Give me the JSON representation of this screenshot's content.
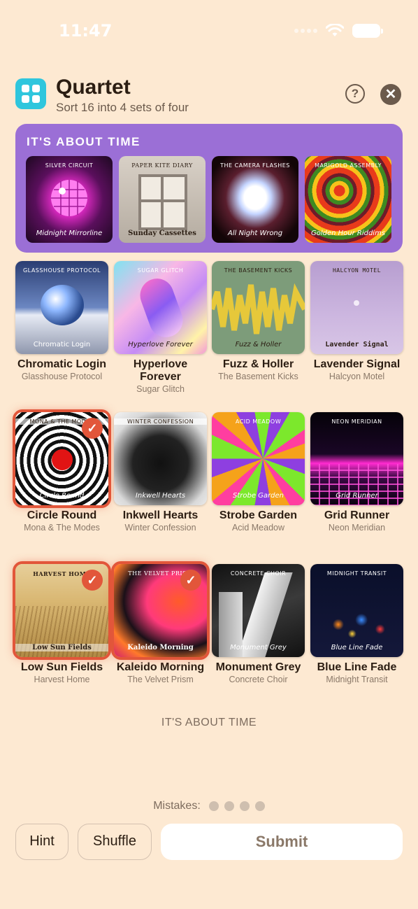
{
  "status": {
    "time": "11:47"
  },
  "header": {
    "title": "Quartet",
    "subtitle": "Sort 16 into 4 sets of four",
    "help_glyph": "?",
    "close_glyph": "✕"
  },
  "solved": {
    "title": "IT'S ABOUT TIME",
    "items": [
      {
        "artist": "SILVER CIRCUIT",
        "title": "Midnight Mirrorline"
      },
      {
        "artist": "PAPER KITE DIARY",
        "title": "Sunday Cassettes"
      },
      {
        "artist": "THE CAMERA FLASHES",
        "title": "All Night Wrong"
      },
      {
        "artist": "MARIGOLD ASSEMBLY",
        "title": "Golden Hour Riddims"
      }
    ]
  },
  "tiles": [
    {
      "name": "Chromatic Login",
      "artist": "Glasshouse Protocol",
      "cover_artist": "GLASSHOUSE PROTOCOL",
      "cover_title": "Chromatic Login",
      "selected": false
    },
    {
      "name": "Hyperlove Forever",
      "artist": "Sugar Glitch",
      "cover_artist": "SUGAR GLITCH",
      "cover_title": "Hyperlove Forever",
      "selected": false
    },
    {
      "name": "Fuzz & Holler",
      "artist": "The Basement Kicks",
      "cover_artist": "THE BASEMENT KICKS",
      "cover_title": "Fuzz & Holler",
      "selected": false
    },
    {
      "name": "Lavender Signal",
      "artist": "Halcyon Motel",
      "cover_artist": "HALCYON MOTEL",
      "cover_title": "Lavender Signal",
      "selected": false
    },
    {
      "name": "Circle Round",
      "artist": "Mona & The Modes",
      "cover_artist": "MONA & THE MODES",
      "cover_title": "Circle Round",
      "selected": true
    },
    {
      "name": "Inkwell Hearts",
      "artist": "Winter Confession",
      "cover_artist": "WINTER CONFESSION",
      "cover_title": "Inkwell Hearts",
      "selected": false
    },
    {
      "name": "Strobe Garden",
      "artist": "Acid Meadow",
      "cover_artist": "ACID MEADOW",
      "cover_title": "Strobe Garden",
      "selected": false
    },
    {
      "name": "Grid Runner",
      "artist": "Neon Meridian",
      "cover_artist": "NEON MERIDIAN",
      "cover_title": "Grid Runner",
      "selected": false
    },
    {
      "name": "Low Sun Fields",
      "artist": "Harvest Home",
      "cover_artist": "HARVEST HOME",
      "cover_title": "Low Sun Fields",
      "selected": true
    },
    {
      "name": "Kaleido Morning",
      "artist": "The Velvet Prism",
      "cover_artist": "THE VELVET PRISM",
      "cover_title": "Kaleido Morning",
      "selected": true
    },
    {
      "name": "Monument Grey",
      "artist": "Concrete Choir",
      "cover_artist": "CONCRETE CHOIR",
      "cover_title": "Monument Grey",
      "selected": false
    },
    {
      "name": "Blue Line Fade",
      "artist": "Midnight Transit",
      "cover_artist": "MIDNIGHT TRANSIT",
      "cover_title": "Blue Line Fade",
      "selected": false
    }
  ],
  "category_hint": "IT'S ABOUT TIME",
  "mistakes": {
    "label": "Mistakes:",
    "remaining": 4
  },
  "buttons": {
    "hint": "Hint",
    "shuffle": "Shuffle",
    "submit": "Submit"
  },
  "colors": {
    "background": "#fde9d2",
    "solved_group": "#9b6fd6",
    "selection": "#e2563a",
    "app_icon": "#2fc6dd"
  }
}
